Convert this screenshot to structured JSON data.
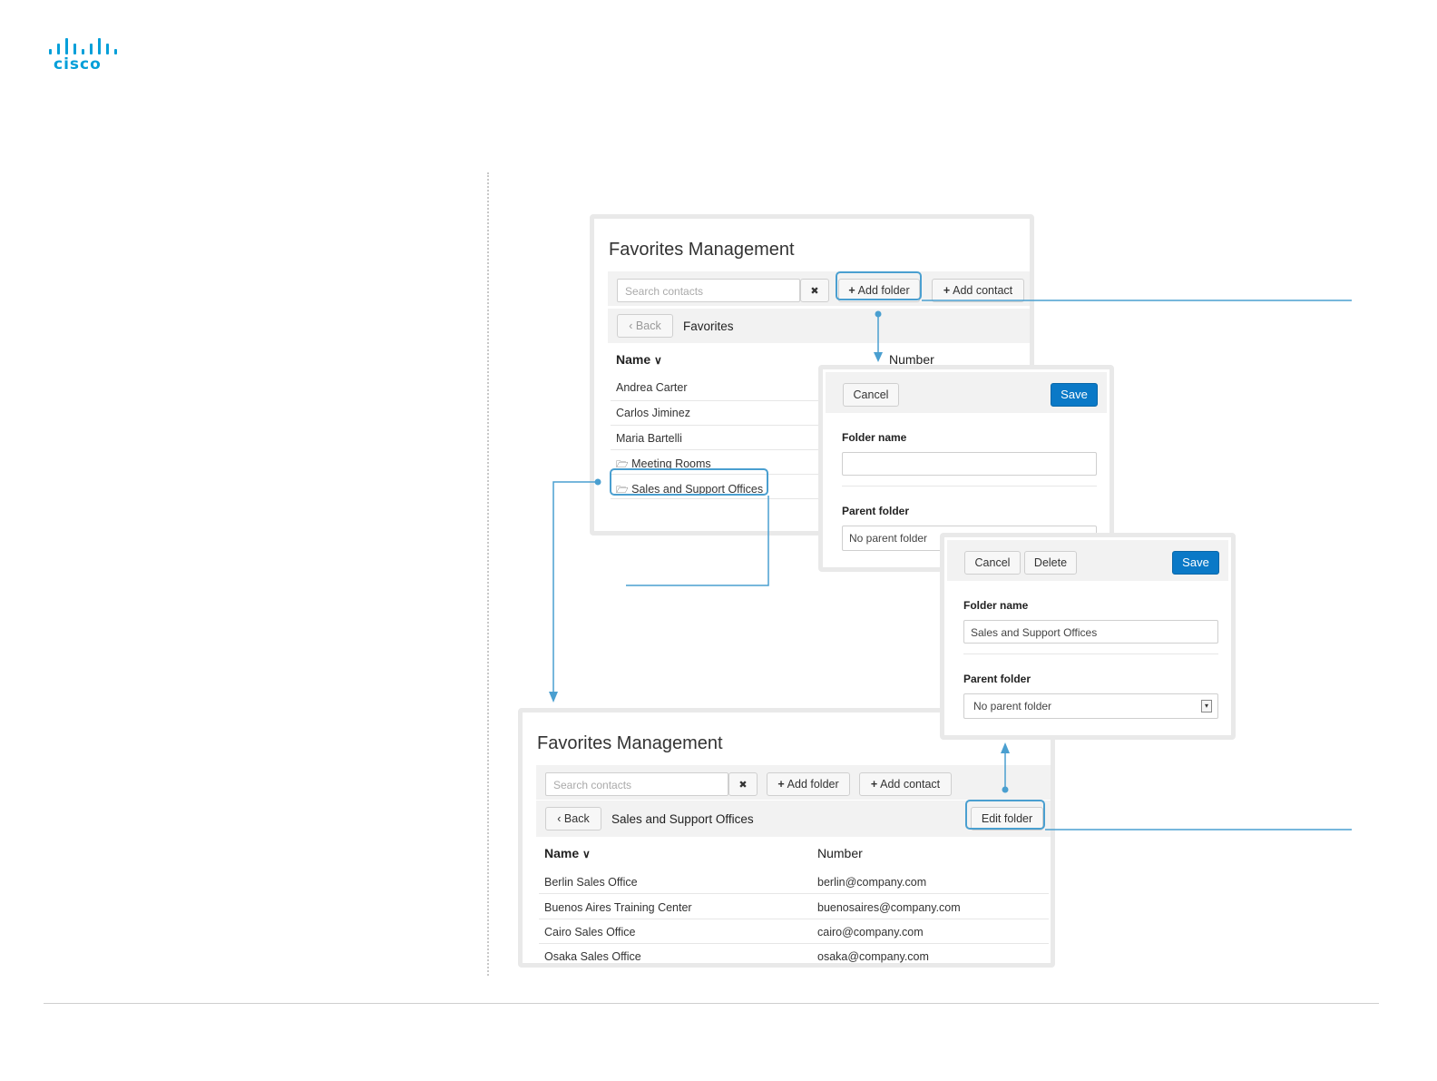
{
  "brand": {
    "logo_text": "cisco",
    "accent": "#049fd9"
  },
  "colors": {
    "primary_button": "#0a79c7",
    "callout_line": "#4a9fd0"
  },
  "panel_top": {
    "title": "Favorites Management",
    "search_placeholder": "Search contacts",
    "clear_icon": "✖",
    "add_folder": "Add folder",
    "add_contact": "Add contact",
    "back": "Back",
    "breadcrumb": "Favorites",
    "col_name": "Name",
    "col_number": "Number",
    "rows": [
      "Andrea Carter",
      "Carlos Jiminez",
      "Maria Bartelli",
      "Meeting Rooms",
      "Sales and Support Offices"
    ]
  },
  "dialog_add": {
    "cancel": "Cancel",
    "save": "Save",
    "folder_name_label": "Folder name",
    "folder_name_value": "",
    "parent_label": "Parent folder",
    "parent_value": "No parent folder"
  },
  "dialog_edit": {
    "cancel": "Cancel",
    "delete": "Delete",
    "save": "Save",
    "folder_name_label": "Folder name",
    "folder_name_value": "Sales and Support Offices",
    "parent_label": "Parent folder",
    "parent_value": "No parent folder"
  },
  "panel_bottom": {
    "title": "Favorites Management",
    "search_placeholder": "Search contacts",
    "clear_icon": "✖",
    "add_folder": "Add folder",
    "add_contact": "Add contact",
    "back": "Back",
    "breadcrumb": "Sales and Support Offices",
    "edit_folder": "Edit folder",
    "col_name": "Name",
    "col_number": "Number",
    "rows": [
      {
        "name": "Berlin Sales Office",
        "number": "berlin@company.com"
      },
      {
        "name": "Buenos Aires Training Center",
        "number": "buenosaires@company.com"
      },
      {
        "name": "Cairo Sales Office",
        "number": "cairo@company.com"
      },
      {
        "name": "Osaka Sales Office",
        "number": "osaka@company.com"
      }
    ]
  }
}
